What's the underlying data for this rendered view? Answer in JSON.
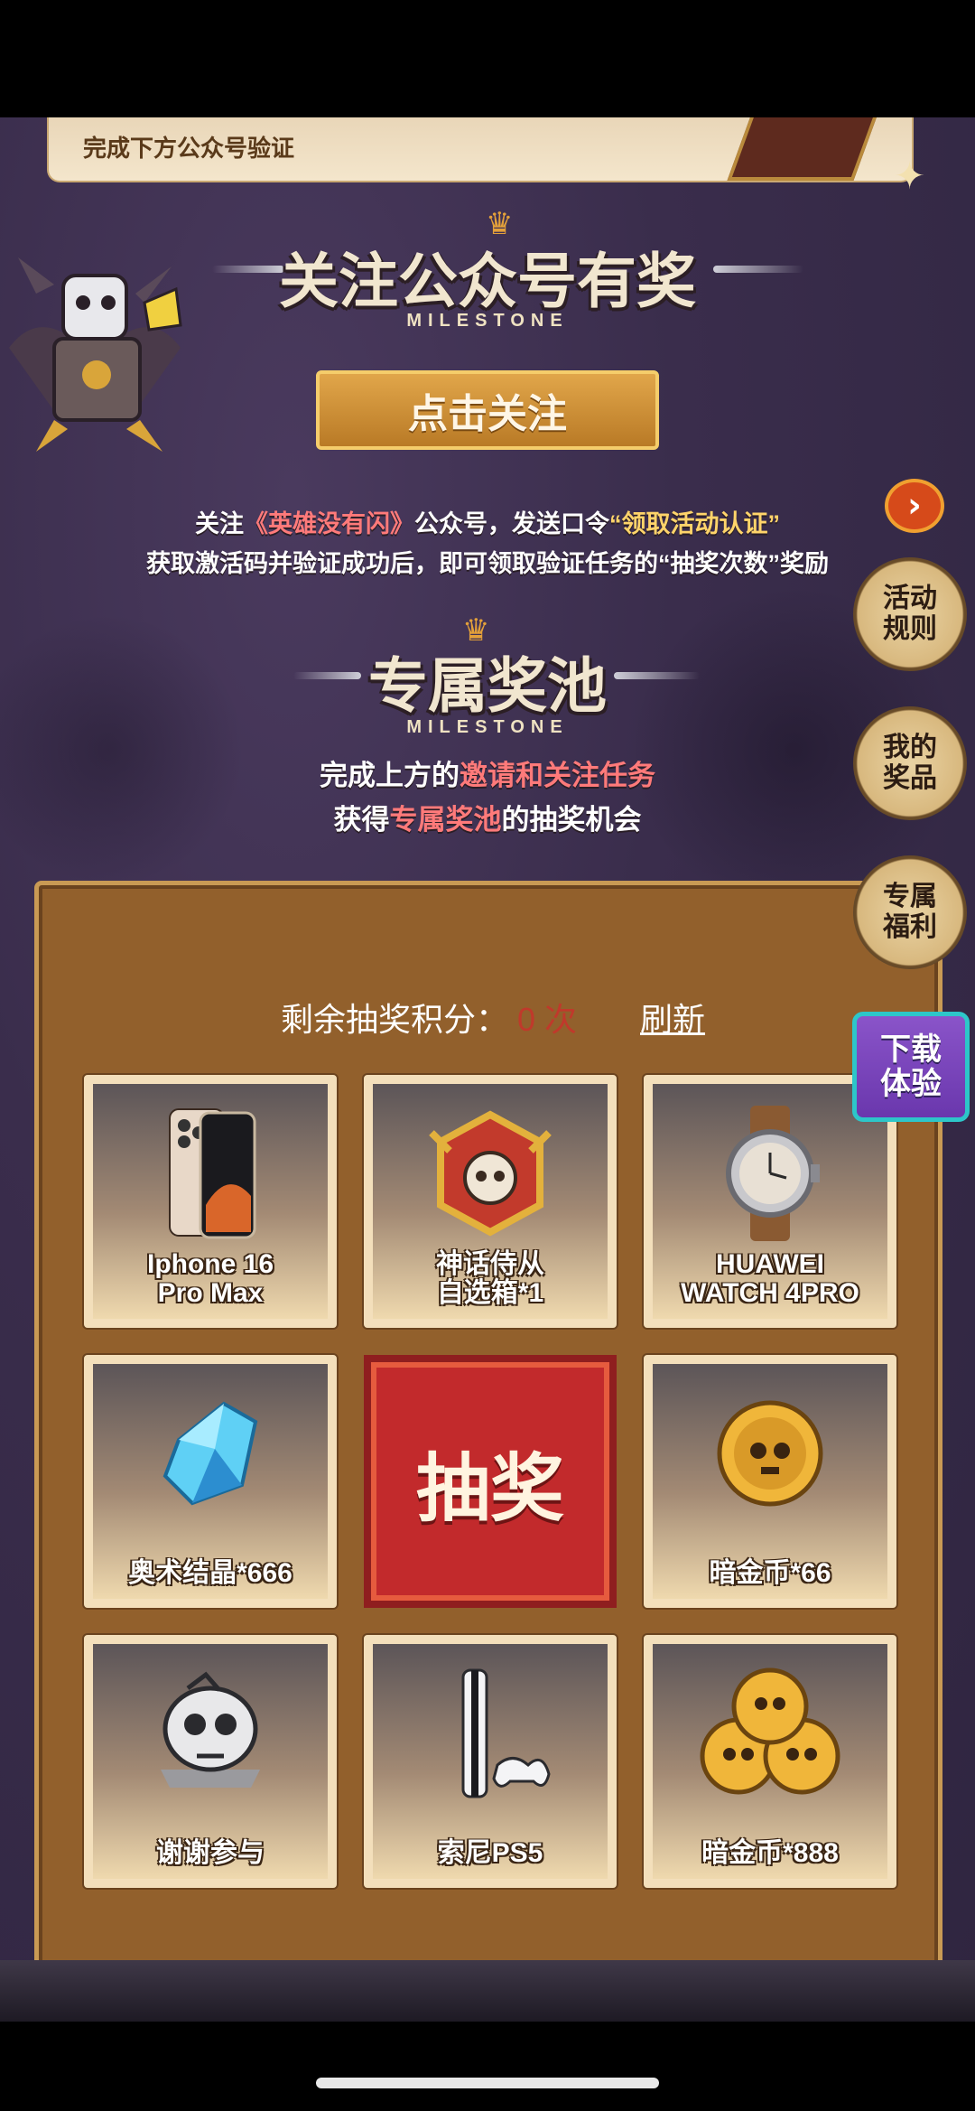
{
  "verify_banner": {
    "text": "完成下方公众号验证"
  },
  "follow_section": {
    "title": "关注公众号有奖",
    "subtitle": "MILESTONE",
    "button_label": "点击关注",
    "desc_line1_a": "关注",
    "desc_line1_b": "《英雄没有闪》",
    "desc_line1_c": "公众号，发送口令",
    "desc_line1_d": "“领取活动认证”",
    "desc_line2": "获取激活码并验证成功后，即可领取验证任务的“抽奖次数”奖励"
  },
  "exclusive_section": {
    "title": "专属奖池",
    "subtitle": "MILESTONE",
    "line1_a": "完成上方的",
    "line1_b": "邀请和关注任务",
    "line2_a": "获得",
    "line2_b": "专属奖池",
    "line2_c": "的抽奖机会"
  },
  "side_buttons": {
    "arrow": "›",
    "rules": "活动规则",
    "my_prizes": "我的奖品",
    "exclusive_benefits": "专属福利",
    "download": "下载体验"
  },
  "points": {
    "label": "剩余抽奖积分：",
    "value": "0 次",
    "refresh": "刷新"
  },
  "prizes": [
    {
      "label": "Iphone 16\nPro Max",
      "icon": "phone-icon"
    },
    {
      "label": "神话侍从\n自选箱*1",
      "icon": "chest-icon"
    },
    {
      "label": "HUAWEI\nWATCH 4PRO",
      "icon": "watch-icon"
    },
    {
      "label": "奥术结晶*666",
      "icon": "crystal-icon"
    },
    {
      "label": "暗金币*66",
      "icon": "coin-icon"
    },
    {
      "label": "谢谢参与",
      "icon": "skull-icon"
    },
    {
      "label": "索尼PS5",
      "icon": "console-icon"
    },
    {
      "label": "暗金币*888",
      "icon": "coins-icon"
    }
  ],
  "draw_button": "抽奖",
  "colors": {
    "accent_red": "#c22a2c",
    "board": "#92602c",
    "gold": "#e1a64a"
  }
}
